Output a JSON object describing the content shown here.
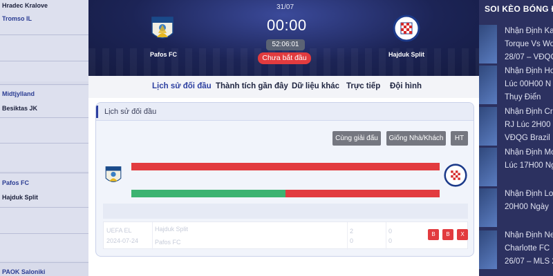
{
  "left_list": {
    "matches": [
      {
        "home": "Hradec Kralove",
        "away": "Tromso IL"
      },
      {
        "home": "Midtjylland",
        "away": "Besiktas JK"
      },
      {
        "home": "Pafos FC",
        "away": "Hajduk Split"
      },
      {
        "home": "PAOK Saloniki",
        "away": ""
      }
    ]
  },
  "match": {
    "date": "31/07",
    "score": "00:00",
    "countdown": "52:06:01",
    "status": "Chưa bắt đầu",
    "home": {
      "name": "Pafos FC",
      "logo_text": "ΠΑΦΟΣ"
    },
    "away": {
      "name": "Hajduk Split",
      "logo_text": "HAJDUK SPLIT"
    }
  },
  "tabs": [
    {
      "label": "Lịch sử đối đầu",
      "active": true
    },
    {
      "label": "Thành tích gần đây",
      "active": false
    },
    {
      "label": "Dữ liệu khác",
      "active": false
    },
    {
      "label": "Trực tiếp",
      "active": false
    },
    {
      "label": "Đội hình",
      "active": false
    }
  ],
  "h2h": {
    "title": "Lịch sử đối đầu",
    "filters": [
      "Cùng giải đấu",
      "Giống Nhà/Khách",
      "HT"
    ],
    "win_bar_fraction": 0.5,
    "row": {
      "league": "UEFA EL",
      "date": "2024-07-24",
      "home_team": "Hajduk Split",
      "away_team": "Pafos FC",
      "home_score": "2",
      "away_score": "0",
      "ht_home": "0",
      "ht_away": "0",
      "results": [
        "B",
        "B",
        "X"
      ]
    }
  },
  "sidebar": {
    "header": "SOI KÈO BÓNG ĐÁ",
    "news": [
      {
        "lines": [
          "Nhận Định Ka",
          "Torque Vs Wo",
          "28/07 – VĐQG"
        ]
      },
      {
        "lines": [
          "Nhận Định Ho",
          "Lúc 00H00 N",
          "Thụy Điển"
        ]
      },
      {
        "lines": [
          "Nhận Định Cr",
          "RJ Lúc 2H00 N",
          "VĐQG Brazil"
        ]
      },
      {
        "lines": [
          "Nhận Định Mo",
          "Lúc 17H00 Ng"
        ]
      },
      {
        "lines": [
          "Nhận Định Lo",
          "20H00 Ngày"
        ]
      },
      {
        "lines": [
          "Nhận Định Ne",
          "Charlotte FC",
          "26/07 – MLS 2"
        ]
      }
    ]
  },
  "colors": {
    "accent": "#2c3fa0",
    "red": "#e23b3f",
    "green": "#3cb371",
    "hero": "#1c2456"
  }
}
